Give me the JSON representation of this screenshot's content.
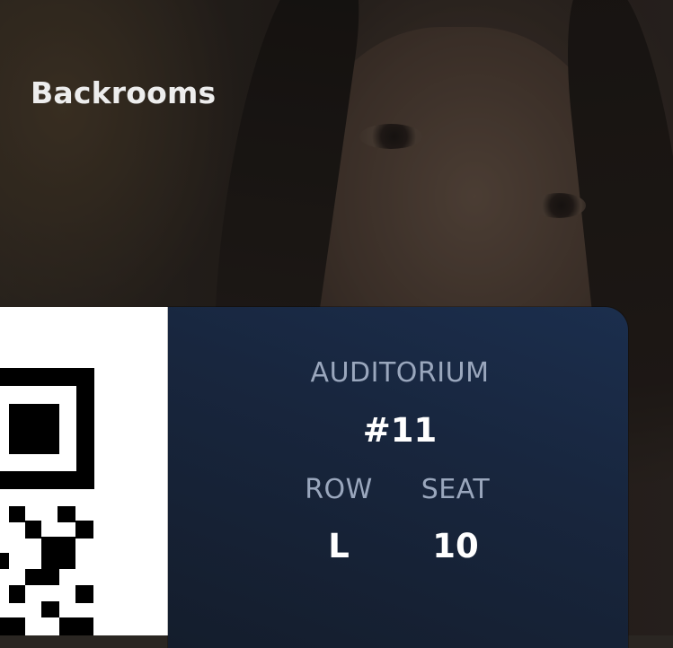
{
  "movie": {
    "title": "Backrooms"
  },
  "ticket": {
    "auditorium_label": "AUDITORIUM",
    "auditorium_value": "#11",
    "row_label": "ROW",
    "row_value": "L",
    "seat_label": "SEAT",
    "seat_value": "10"
  },
  "colors": {
    "panel": "#18263e",
    "label": "#9aa7bd",
    "value": "#ffffff"
  },
  "icons": {
    "qr": "qr-code-icon"
  }
}
